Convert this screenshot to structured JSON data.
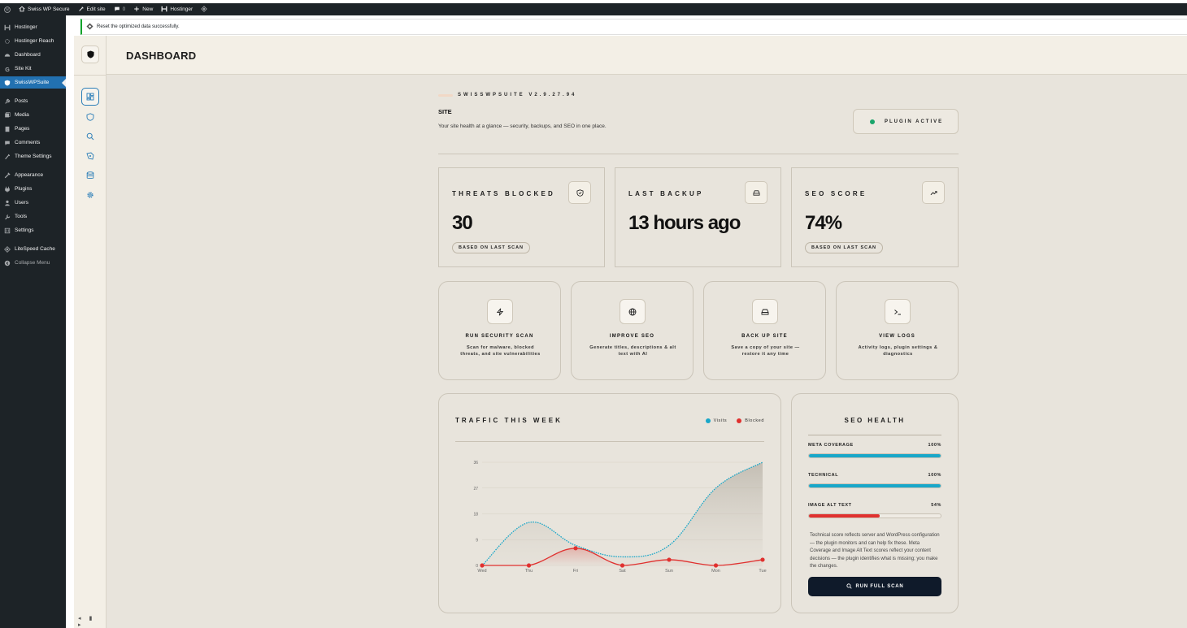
{
  "admin_bar": {
    "site_name": "Swiss WP Secure",
    "edit_site": "Edit site",
    "comments_count": "0",
    "new_label": "New",
    "hostinger_label": "Hostinger"
  },
  "wp_menu": {
    "items": [
      {
        "label": "Hostinger",
        "icon": "hostinger-icon"
      },
      {
        "label": "Hostinger Reach",
        "icon": "reach-icon"
      },
      {
        "label": "Dashboard",
        "icon": "dashboard-icon"
      },
      {
        "label": "Site Kit",
        "icon": "google-icon"
      },
      {
        "label": "SwissWPSuite",
        "icon": "shield-icon"
      },
      {
        "label": "Posts",
        "icon": "pin-icon"
      },
      {
        "label": "Media",
        "icon": "media-icon"
      },
      {
        "label": "Pages",
        "icon": "pages-icon"
      },
      {
        "label": "Comments",
        "icon": "comment-icon"
      },
      {
        "label": "Theme Settings",
        "icon": "brush-icon"
      },
      {
        "label": "Appearance",
        "icon": "appearance-icon"
      },
      {
        "label": "Plugins",
        "icon": "plugin-icon"
      },
      {
        "label": "Users",
        "icon": "user-icon"
      },
      {
        "label": "Tools",
        "icon": "wrench-icon"
      },
      {
        "label": "Settings",
        "icon": "settings-icon"
      },
      {
        "label": "LiteSpeed Cache",
        "icon": "diamond-icon"
      },
      {
        "label": "Collapse Menu",
        "icon": "collapse-icon"
      }
    ],
    "active": "SwissWPSuite"
  },
  "notice": {
    "text": "Reset the optimized data successfully."
  },
  "page": {
    "title": "DASHBOARD"
  },
  "header": {
    "brand": "SWISSWPSUITE V2.9.27.94",
    "site": "SITE",
    "subtitle": "Your site health at a glance — security, backups, and SEO in one place.",
    "status": "PLUGIN ACTIVE",
    "status_color": "#1aa56b"
  },
  "stats": [
    {
      "label": "THREATS BLOCKED",
      "value": "30",
      "badge": "BASED ON LAST SCAN",
      "icon": "shield-check-icon"
    },
    {
      "label": "LAST BACKUP",
      "value": "13 hours ago",
      "badge": "",
      "icon": "drive-icon"
    },
    {
      "label": "SEO SCORE",
      "value": "74%",
      "badge": "BASED ON LAST SCAN",
      "icon": "trending-up-icon"
    }
  ],
  "actions": [
    {
      "title": "RUN SECURITY SCAN",
      "desc": "Scan for malware, blocked threats, and site vulnerabilities",
      "icon": "bolt-icon"
    },
    {
      "title": "IMPROVE SEO",
      "desc": "Generate titles, descriptions & alt text with AI",
      "icon": "globe-icon"
    },
    {
      "title": "BACK UP SITE",
      "desc": "Save a copy of your site — restore it any time",
      "icon": "drive-icon"
    },
    {
      "title": "VIEW LOGS",
      "desc": "Activity logs, plugin settings & diagnostics",
      "icon": "terminal-icon"
    }
  ],
  "traffic": {
    "title": "TRAFFIC THIS WEEK"
  },
  "chart_data": {
    "type": "line",
    "title": "TRAFFIC THIS WEEK",
    "categories": [
      "Wed",
      "Thu",
      "Fri",
      "Sat",
      "Sun",
      "Mon",
      "Tue"
    ],
    "series": [
      {
        "name": "Visits",
        "values": [
          0,
          15,
          7,
          3,
          7,
          27,
          36
        ],
        "color": "#19a7c9"
      },
      {
        "name": "Blocked",
        "values": [
          0,
          0,
          6,
          0,
          2,
          0,
          2
        ],
        "color": "#e0312f"
      }
    ],
    "yticks": [
      0,
      9,
      18,
      27,
      36
    ],
    "ylim": [
      0,
      36
    ],
    "grid": true,
    "legend": "top-right"
  },
  "seo_health": {
    "title": "SEO HEALTH",
    "metrics": [
      {
        "label": "META COVERAGE",
        "value": "100%",
        "percent": 100,
        "color": "#19a7c9"
      },
      {
        "label": "TECHNICAL",
        "value": "100%",
        "percent": 100,
        "color": "#19a7c9"
      },
      {
        "label": "IMAGE ALT TEXT",
        "value": "54%",
        "percent": 54,
        "color": "#e0312f"
      }
    ],
    "note": "Technical score reflects server and WordPress configuration — the plugin monitors and can help fix these. Meta Coverage and Image Alt Text scores reflect your content decisions — the plugin identifies what is missing; you make the changes.",
    "button": "RUN FULL SCAN"
  }
}
